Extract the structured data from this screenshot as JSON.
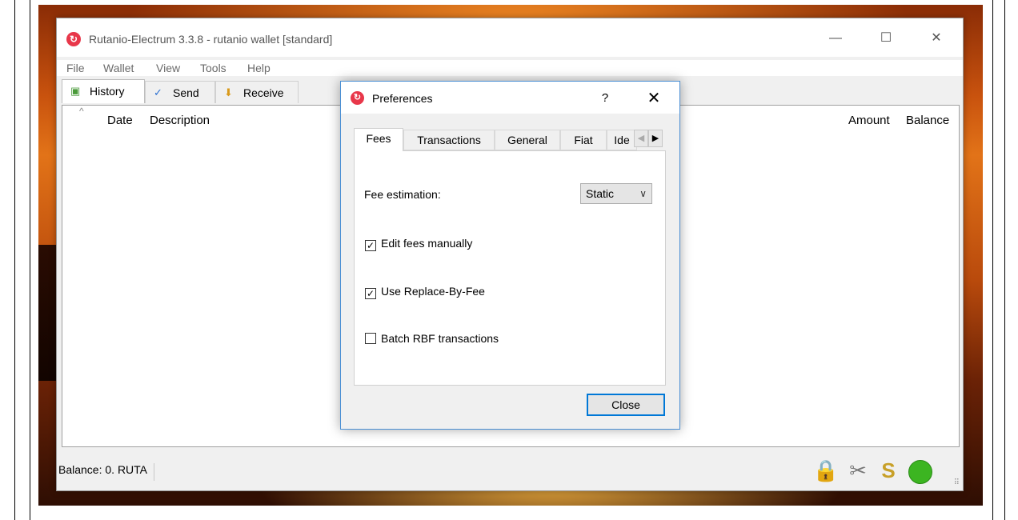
{
  "window": {
    "title": "Rutanio-Electrum 3.3.8  -  rutanio wallet  [standard]",
    "controls": {
      "minimize": "—",
      "maximize": "☐",
      "close": "✕"
    }
  },
  "menu": [
    "File",
    "Wallet",
    "View",
    "Tools",
    "Help"
  ],
  "tabs": [
    {
      "label": "History",
      "icon": "history-icon"
    },
    {
      "label": "Send",
      "icon": "send-icon"
    },
    {
      "label": "Receive",
      "icon": "receive-icon"
    }
  ],
  "history": {
    "columns": [
      "Date",
      "Description",
      "Amount",
      "Balance"
    ]
  },
  "status": {
    "balance": "Balance: 0. RUTA",
    "icons": [
      "lock-icon",
      "preferences-icon",
      "seed-icon",
      "network-status-icon"
    ],
    "network_color": "#3cb521"
  },
  "dialog": {
    "title": "Preferences",
    "help": "?",
    "close": "✕",
    "tabs": [
      "Fees",
      "Transactions",
      "General",
      "Fiat",
      "Ide"
    ],
    "active_tab": "Fees",
    "fee_estimation": {
      "label": "Fee estimation:",
      "value": "Static"
    },
    "checkboxes": [
      {
        "label": "Edit fees manually",
        "checked": true
      },
      {
        "label": "Use Replace-By-Fee",
        "checked": true
      },
      {
        "label": "Batch RBF transactions",
        "checked": false
      }
    ],
    "close_button": "Close"
  },
  "colors": {
    "accent": "#0078d7",
    "logo": "#e8374a"
  }
}
